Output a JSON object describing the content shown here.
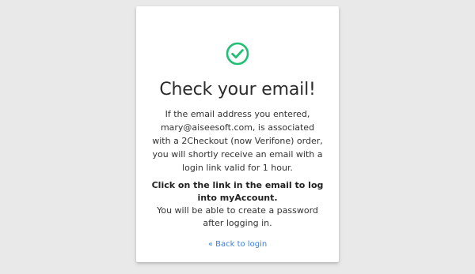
{
  "colors": {
    "background": "#e9e9e9",
    "card": "#ffffff",
    "success_icon": "#1fbf74",
    "link": "#3d7fd6",
    "text": "#333333"
  },
  "icon": {
    "name": "check-circle-icon"
  },
  "title": "Check your email!",
  "message": {
    "paragraph": "If the email address you entered, mary@aiseesoft.com, is associated with a 2Checkout (now Verifone) order, you will shortly receive an email with a login link valid for 1 hour.",
    "instruction_bold": "Click on the link in the email to log into myAccount.",
    "instruction_normal": "You will be able to create a password after logging in."
  },
  "back_link": "« Back to login"
}
